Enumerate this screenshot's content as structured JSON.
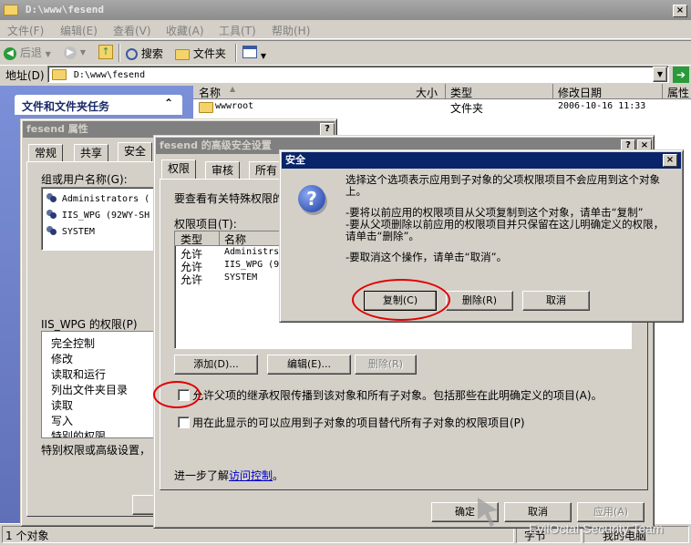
{
  "explorer": {
    "title": "D:\\www\\fesend",
    "menu": [
      "文件(F)",
      "编辑(E)",
      "查看(V)",
      "收藏(A)",
      "工具(T)",
      "帮助(H)"
    ],
    "toolbar": {
      "back": "后退",
      "search": "搜索",
      "folders": "文件夹"
    },
    "address_label": "地址(D)",
    "address_value": "D:\\www\\fesend",
    "tasks_title": "文件和文件夹任务",
    "columns": [
      "名称",
      "大小",
      "类型",
      "修改日期",
      "属性"
    ],
    "rows": [
      {
        "name": "wwwroot",
        "size": "",
        "type": "文件夹",
        "date": "2006-10-16 11:33",
        "attr": ""
      }
    ],
    "status_left": "1 个对象",
    "status_mid": "字节",
    "status_right": "我的电脑"
  },
  "properties": {
    "title": "fesend 属性",
    "tabs": [
      "常规",
      "共享",
      "安全"
    ],
    "group_label": "组或用户名称(G):",
    "users": [
      "Administrators (",
      "IIS_WPG (92WY-SH",
      "SYSTEM"
    ],
    "perm_label": "IIS_WPG 的权限(P)",
    "perms": [
      "完全控制",
      "修改",
      "读取和运行",
      "列出文件夹目录",
      "读取",
      "写入",
      "特别的权限"
    ],
    "special_text": "特别权限或高级设置，"
  },
  "advanced": {
    "title": "fesend 的高级安全设置",
    "tabs": [
      "权限",
      "审核",
      "所有"
    ],
    "intro": "要查看有关特殊权限的",
    "entries_label": "权限项目(T):",
    "col_type": "类型",
    "col_name": "名称",
    "entries": [
      {
        "type": "允许",
        "name": "Administrs"
      },
      {
        "type": "允许",
        "name": "IIS_WPG (9"
      },
      {
        "type": "允许",
        "name": "SYSTEM"
      }
    ],
    "add_btn": "添加(D)...",
    "edit_btn": "编辑(E)...",
    "remove_btn": "删除(R)",
    "inherit_text": "允许父项的继承权限传播到该对象和所有子对象。包括那些在此明确定义的项目(A)。",
    "replace_text": "用在此显示的可以应用到子对象的项目替代所有子对象的权限项目(P)",
    "learn_prefix": "进一步了解",
    "learn_link": "访问控制",
    "learn_suffix": "。",
    "ok": "确定",
    "cancel": "取消",
    "apply": "应用(A)"
  },
  "security_dialog": {
    "title": "安全",
    "msg1": "选择这个选项表示应用到子对象的父项权限项目不会应用到这个对象上。",
    "msg2": "-要将以前应用的权限项目从父项复制到这个对象，请单击“复制”",
    "msg3": "-要从父项删除以前应用的权限项目并只保留在这儿明确定义的权限，请单击“删除”。",
    "msg4": "-要取消这个操作，请单击“取消”。",
    "copy_btn": "复制(C)",
    "remove_btn": "删除(R)",
    "cancel_btn": "取消"
  },
  "watermark": "EvilOctal Security Team"
}
